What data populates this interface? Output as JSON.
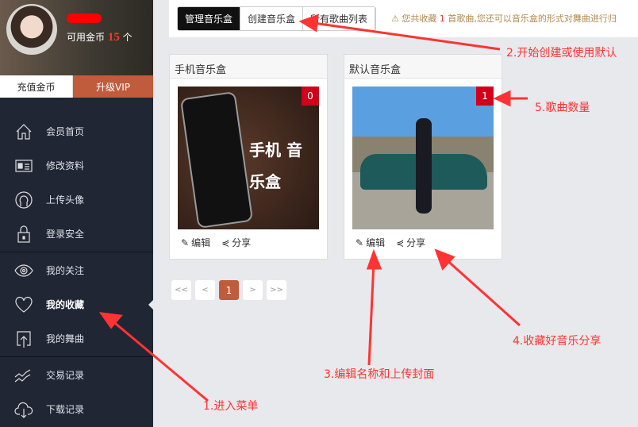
{
  "profile": {
    "coins_label": "可用金币",
    "coins": "15",
    "coins_unit": "个",
    "recharge": "充值金币",
    "vip": "升级VIP"
  },
  "nav": [
    {
      "label": "会员首页",
      "icon": "home-icon"
    },
    {
      "label": "修改资料",
      "icon": "id-card-icon"
    },
    {
      "label": "上传头像",
      "icon": "user-icon"
    },
    {
      "label": "登录安全",
      "icon": "lock-icon"
    },
    {
      "label": "我的关注",
      "icon": "eye-icon"
    },
    {
      "label": "我的收藏",
      "icon": "heart-icon",
      "active": true
    },
    {
      "label": "我的舞曲",
      "icon": "upload-icon"
    },
    {
      "label": "交易记录",
      "icon": "chart-icon"
    },
    {
      "label": "下载记录",
      "icon": "cloud-download-icon"
    }
  ],
  "tabs": [
    "管理音乐盒",
    "创建音乐盒",
    "所有歌曲列表"
  ],
  "notice": {
    "pre": "您共收藏",
    "count": "1",
    "post": "首歌曲,您还可以音乐盒的形式对舞曲进行归"
  },
  "boxes": [
    {
      "title": "手机音乐盒",
      "count": "0",
      "cover_text": "手机 音乐盒",
      "edit": "编辑",
      "share": "分享"
    },
    {
      "title": "默认音乐盒",
      "count": "1",
      "edit": "编辑",
      "share": "分享"
    }
  ],
  "pager": [
    "<<",
    "<",
    "1",
    ">",
    ">>"
  ],
  "annotations": {
    "a1": "1.进入菜单",
    "a2": "2.开始创建或使用默认",
    "a3": "3.编辑名称和上传封面",
    "a4": "4.收藏好音乐分享",
    "a5": "5.歌曲数量"
  },
  "colors": {
    "sidebar": "#212634",
    "accent": "#c05c3c",
    "badge": "#d0021b",
    "annotation": "#ff3333"
  }
}
